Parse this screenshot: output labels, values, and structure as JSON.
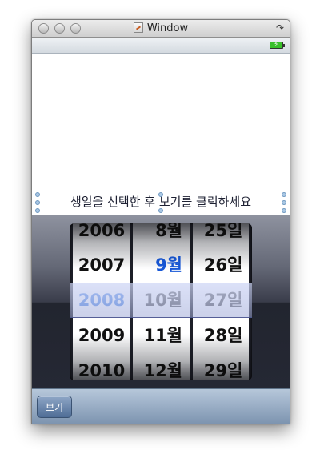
{
  "window": {
    "title": "Window"
  },
  "content": {
    "instruction": "생일을 선택한 후 보기를 클릭하세요"
  },
  "picker": {
    "years": [
      "2006",
      "2007",
      "2008",
      "2009",
      "2010"
    ],
    "months": [
      "8월",
      "9월",
      "10월",
      "11월",
      "12월"
    ],
    "days": [
      "25일",
      "26일",
      "27일",
      "28일",
      "29일"
    ],
    "selected": {
      "year": "2008",
      "month": "9월",
      "day": "27일"
    },
    "highlight_color": "#1757d6"
  },
  "toolbar": {
    "view_label": "보기"
  }
}
